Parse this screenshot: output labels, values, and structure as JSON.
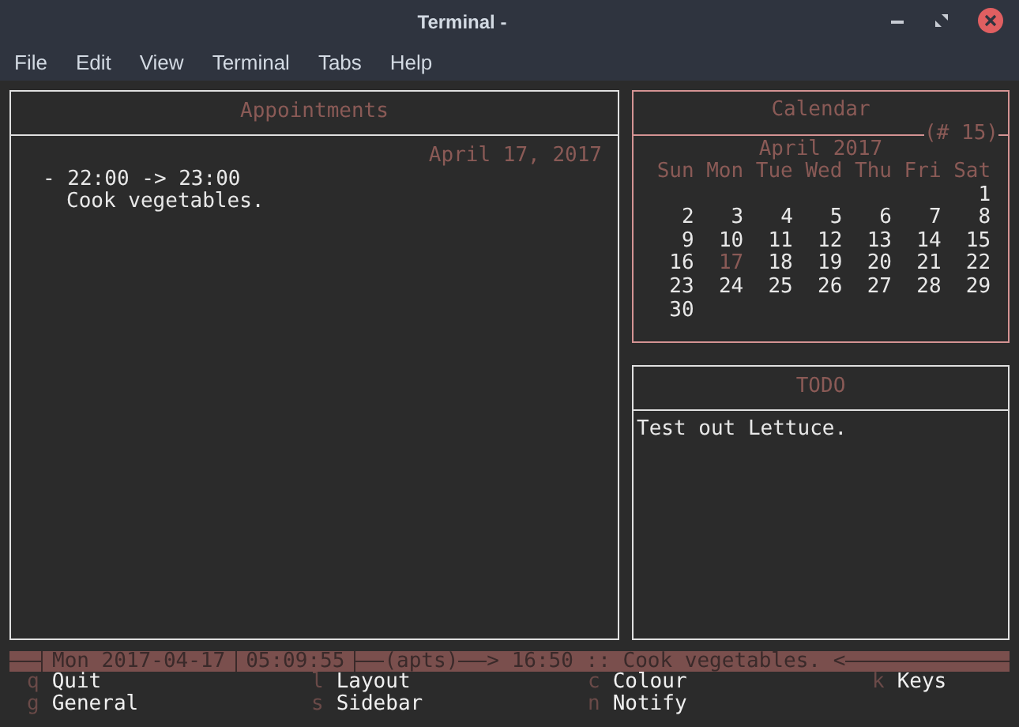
{
  "window": {
    "title": "Terminal -"
  },
  "menu": [
    "File",
    "Edit",
    "View",
    "Terminal",
    "Tabs",
    "Help"
  ],
  "appointments": {
    "title": "Appointments",
    "date": "April 17, 2017",
    "items": [
      {
        "time": "- 22:00 -> 23:00",
        "text": "Cook vegetables."
      }
    ]
  },
  "calendar": {
    "title": "Calendar",
    "week": "(# 15)",
    "month": "April 2017",
    "weekdays": [
      "Sun",
      "Mon",
      "Tue",
      "Wed",
      "Thu",
      "Fri",
      "Sat"
    ],
    "days": [
      {
        "day": "1",
        "selected": false
      },
      {
        "day": "2",
        "selected": false
      },
      {
        "day": "3",
        "selected": false
      },
      {
        "day": "4",
        "selected": false
      },
      {
        "day": "5",
        "selected": false
      },
      {
        "day": "6",
        "selected": false
      },
      {
        "day": "7",
        "selected": false
      },
      {
        "day": "8",
        "selected": false
      },
      {
        "day": "9",
        "selected": false
      },
      {
        "day": "10",
        "selected": false
      },
      {
        "day": "11",
        "selected": false
      },
      {
        "day": "12",
        "selected": false
      },
      {
        "day": "13",
        "selected": false
      },
      {
        "day": "14",
        "selected": false
      },
      {
        "day": "15",
        "selected": false
      },
      {
        "day": "16",
        "selected": false
      },
      {
        "day": "17",
        "selected": true
      },
      {
        "day": "18",
        "selected": false
      },
      {
        "day": "19",
        "selected": false
      },
      {
        "day": "20",
        "selected": false
      },
      {
        "day": "21",
        "selected": false
      },
      {
        "day": "22",
        "selected": false
      },
      {
        "day": "23",
        "selected": false
      },
      {
        "day": "24",
        "selected": false
      },
      {
        "day": "25",
        "selected": false
      },
      {
        "day": "26",
        "selected": false
      },
      {
        "day": "27",
        "selected": false
      },
      {
        "day": "28",
        "selected": false
      },
      {
        "day": "29",
        "selected": false
      },
      {
        "day": "30",
        "selected": false
      }
    ]
  },
  "todo": {
    "title": "TODO",
    "items": [
      "Test out Lettuce."
    ]
  },
  "status_bar": {
    "date": "Mon 2017-04-17",
    "time": "05:09:55",
    "mode": "(apts)",
    "next": "> 16:50 :: Cook vegetables. <"
  },
  "keys": [
    {
      "key": "q",
      "label": "Quit"
    },
    {
      "key": "l",
      "label": "Layout"
    },
    {
      "key": "c",
      "label": "Colour"
    },
    {
      "key": "k",
      "label": "Keys"
    },
    {
      "key": "g",
      "label": "General"
    },
    {
      "key": "s",
      "label": "Sidebar"
    },
    {
      "key": "n",
      "label": "Notify"
    }
  ]
}
